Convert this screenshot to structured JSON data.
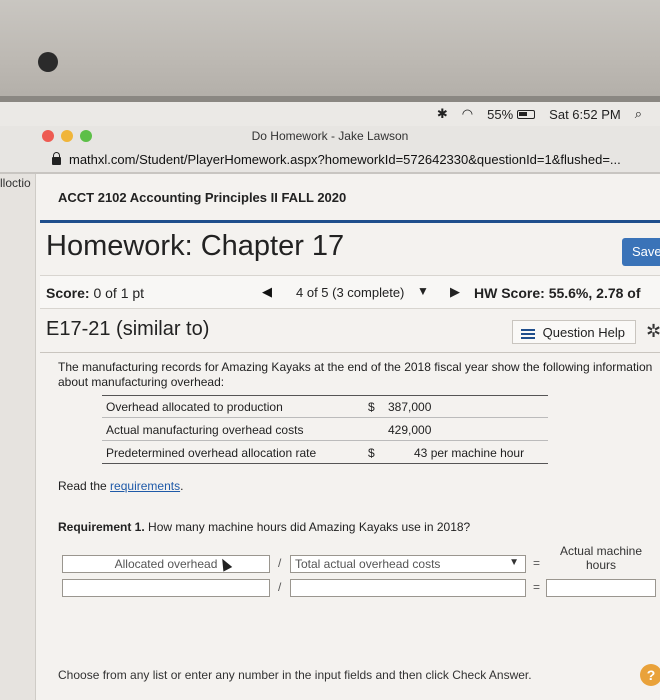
{
  "menubar": {
    "wifi_icon": "wifi-icon",
    "battery_percent": "55%",
    "clock": "Sat 6:52 PM",
    "search_icon": "search-icon"
  },
  "browser": {
    "window_title": "Do Homework - Jake Lawson",
    "url": "mathxl.com/Student/PlayerHomework.aspx?homeworkId=572642330&questionId=1&flushed=..."
  },
  "sidebar": {
    "tab_fragment": "lloctio"
  },
  "course": {
    "title": "ACCT 2102 Accounting Principles II FALL 2020"
  },
  "homework": {
    "title": "Homework: Chapter 17",
    "save_label": "Save",
    "score_label": "Score:",
    "score_value": "0 of 1 pt",
    "progress": "4 of 5 (3 complete)",
    "hw_score_label": "HW Score:",
    "hw_score_value": "55.6%, 2.78 of"
  },
  "exercise": {
    "title": "E17-21 (similar to)",
    "help_label": "Question Help",
    "intro": "The manufacturing records for Amazing Kayaks at the end of the 2018 fiscal year show the following information about manufacturing overhead:",
    "rows": [
      {
        "label": "Overhead allocated to production",
        "currency": "$",
        "value": "387,000",
        "suffix": ""
      },
      {
        "label": "Actual manufacturing overhead costs",
        "currency": "",
        "value": "429,000",
        "suffix": ""
      },
      {
        "label": "Predetermined overhead allocation rate",
        "currency": "$",
        "value": "43",
        "suffix": "per machine hour"
      }
    ],
    "read_prefix": "Read the ",
    "read_link": "requirements",
    "read_suffix": ".",
    "req1_label": "Requirement 1.",
    "req1_text": "How many machine hours did Amazing Kayaks use in 2018?",
    "col_header": "Actual machine hours",
    "select1_value": "Allocated overhead",
    "select2_value": "Total actual overhead costs",
    "op_divide": "/",
    "op_equals": "=",
    "instructions": "Choose from any list or enter any number in the input fields and then click Check Answer.",
    "help_glyph": "?"
  },
  "colors": {
    "accent": "#1f4e8c",
    "save_button": "#3a73b8",
    "link": "#1f5aa8",
    "help_circle": "#e9a23a"
  }
}
